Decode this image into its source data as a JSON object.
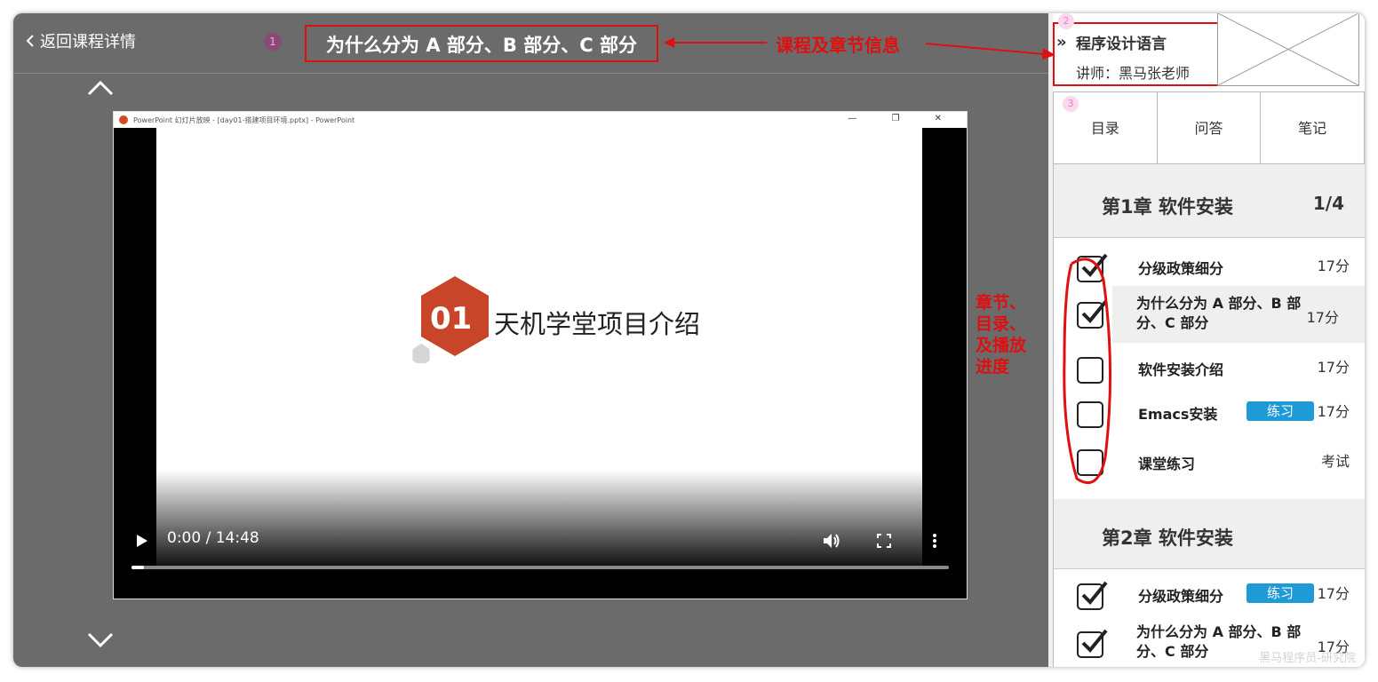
{
  "header": {
    "back_label": "返回课程详情",
    "badge": "1",
    "lesson_title": "为什么分为 A 部分、B 部分、C 部分"
  },
  "annotations": {
    "course_info": "课程及章节信息",
    "chapter_progress": [
      "章节、",
      "目录、",
      "及播放",
      "进度"
    ]
  },
  "video": {
    "window_title": "PowerPoint 幻灯片放映 - [day01-搭建项目环境.pptx] - PowerPoint",
    "window_controls": "— ❐ ✕",
    "slide_number": "01",
    "slide_title": "天机学堂项目介绍",
    "time": "0:00 / 14:48",
    "progress_fraction": 0.015
  },
  "course": {
    "badge": "2",
    "name": "程序设计语言",
    "teacher": "讲师：黑马张老师"
  },
  "tabs": {
    "badge": "3",
    "items": [
      "目录",
      "问答",
      "笔记"
    ]
  },
  "chapters": [
    {
      "title": "第1章 软件安装",
      "progress": "1/4",
      "items": [
        {
          "label": "分级政策细分",
          "duration": "17分",
          "checked": true,
          "tag": ""
        },
        {
          "label": "为什么分为 A 部分、B 部分、C 部分",
          "duration": "17分",
          "checked": true,
          "tag": ""
        },
        {
          "label": "软件安装介绍",
          "duration": "17分",
          "checked": false,
          "tag": ""
        },
        {
          "label": "Emacs安装",
          "duration": "17分",
          "checked": false,
          "tag": "练习"
        },
        {
          "label": "课堂练习",
          "duration": "考试",
          "checked": false,
          "tag": ""
        }
      ]
    },
    {
      "title": "第2章 软件安装",
      "progress": "",
      "items": [
        {
          "label": "分级政策细分",
          "duration": "17分",
          "checked": true,
          "tag": "练习"
        },
        {
          "label": "为什么分为 A 部分、B 部分、C 部分",
          "duration": "17分",
          "checked": true,
          "tag": ""
        }
      ]
    }
  ],
  "watermark": "黑马程序员-研究院",
  "colors": {
    "annotation": "#e01010",
    "tag": "#1e9ad6",
    "slide_hex": "#c9452a"
  }
}
